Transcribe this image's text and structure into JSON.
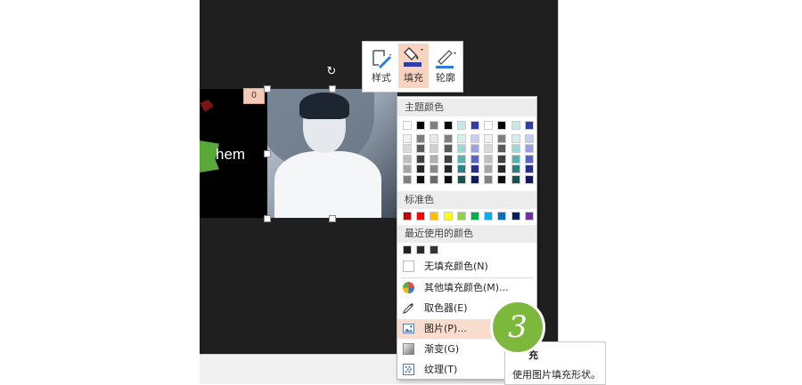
{
  "slide": {
    "left_text": "hem",
    "badge": "0"
  },
  "toolbar": {
    "style_label": "样式",
    "fill_label": "填充",
    "outline_label": "轮廓",
    "fill_color": "#2f3da8",
    "outline_color": "#2a7fd4"
  },
  "menu": {
    "theme_header": "主题颜色",
    "theme_top": [
      "#ffffff",
      "#000000",
      "#7f7f7f",
      "#000000",
      "#c8e8e8",
      "#2f3da8",
      "#ffffff",
      "#000000",
      "#c8e8e8",
      "#2f3da8"
    ],
    "theme_columns": [
      [
        "#f2f2f2",
        "#d9d9d9",
        "#bfbfbf",
        "#a6a6a6",
        "#7f7f7f"
      ],
      [
        "#7f7f7f",
        "#595959",
        "#404040",
        "#262626",
        "#0d0d0d"
      ],
      [
        "#e8e8e8",
        "#cfcfcf",
        "#b0b0b0",
        "#8a8a8a",
        "#6a6a6a"
      ],
      [
        "#7f7f7f",
        "#595959",
        "#404040",
        "#262626",
        "#0d0d0d"
      ],
      [
        "#d6eeee",
        "#9fd6d6",
        "#58b0b0",
        "#2e8080",
        "#1a5050"
      ],
      [
        "#c8ccf0",
        "#9aa0e0",
        "#5a64c8",
        "#27308a",
        "#151a5a"
      ],
      [
        "#f2f2f2",
        "#d9d9d9",
        "#bfbfbf",
        "#a6a6a6",
        "#7f7f7f"
      ],
      [
        "#7f7f7f",
        "#595959",
        "#404040",
        "#262626",
        "#0d0d0d"
      ],
      [
        "#d6eeee",
        "#9fd6d6",
        "#58b0b0",
        "#2e8080",
        "#1a5050"
      ],
      [
        "#c8ccf0",
        "#9aa0e0",
        "#5a64c8",
        "#27308a",
        "#151a5a"
      ]
    ],
    "standard_header": "标准色",
    "standard_colors": [
      "#c00000",
      "#ff0000",
      "#ffc000",
      "#ffff00",
      "#92d050",
      "#00b050",
      "#00b0f0",
      "#0070c0",
      "#002060",
      "#7030a0"
    ],
    "recent_header": "最近使用的颜色",
    "recent_colors": [
      "#1f1f1f",
      "#2a2a2a",
      "#333333"
    ],
    "items": {
      "no_fill": "无填充颜色(N)",
      "more_fill": "其他填充颜色(M)...",
      "eyedropper": "取色器(E)",
      "picture": "图片(P)...",
      "gradient": "渐变(G)",
      "texture": "纹理(T)"
    }
  },
  "step_number": "3",
  "tooltip": {
    "title": "充",
    "desc": "使用图片填充形状。"
  }
}
